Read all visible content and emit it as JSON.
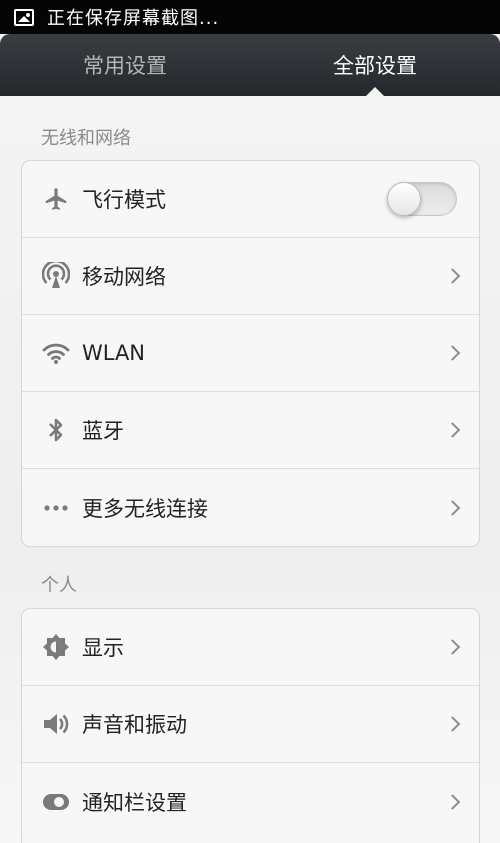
{
  "status_bar": {
    "text": "正在保存屏幕截图...",
    "icon": "screenshot-image-icon"
  },
  "tabs": [
    {
      "label": "常用设置",
      "active": false
    },
    {
      "label": "全部设置",
      "active": true
    }
  ],
  "sections": [
    {
      "header": "无线和网络",
      "items": [
        {
          "label": "飞行模式",
          "icon": "airplane-icon",
          "control": "toggle",
          "toggle_on": false
        },
        {
          "label": "移动网络",
          "icon": "cellular-antenna-icon",
          "control": "chevron"
        },
        {
          "label": "WLAN",
          "icon": "wifi-icon",
          "control": "chevron"
        },
        {
          "label": "蓝牙",
          "icon": "bluetooth-icon",
          "control": "chevron"
        },
        {
          "label": "更多无线连接",
          "icon": "more-dots-icon",
          "control": "chevron"
        }
      ]
    },
    {
      "header": "个人",
      "items": [
        {
          "label": "显示",
          "icon": "brightness-icon",
          "control": "chevron"
        },
        {
          "label": "声音和振动",
          "icon": "speaker-icon",
          "control": "chevron"
        },
        {
          "label": "通知栏设置",
          "icon": "notification-toggle-icon",
          "control": "chevron"
        }
      ]
    }
  ],
  "colors": {
    "tab_bar": "#2e3136",
    "tab_active_text": "#ffffff",
    "tab_inactive_text": "#b5b5b5",
    "icon_gray": "#7a7a7a"
  }
}
